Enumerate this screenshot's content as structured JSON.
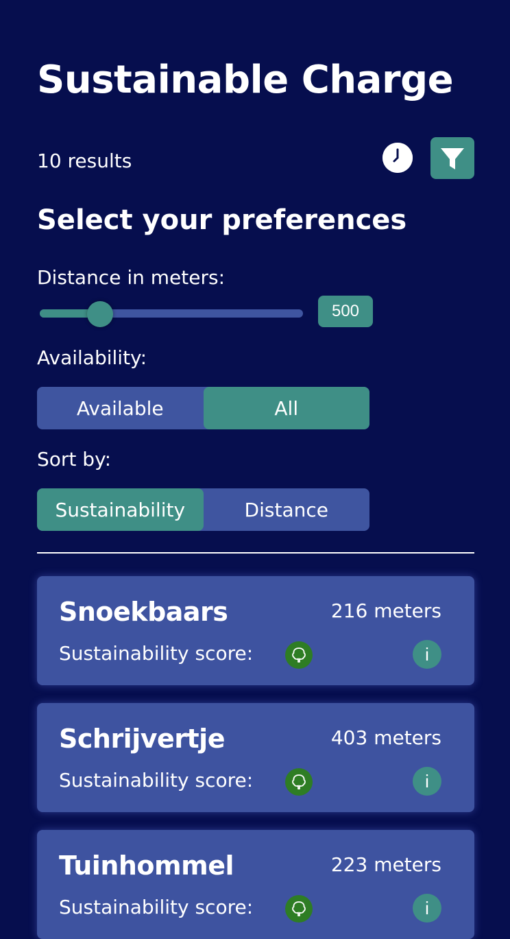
{
  "app": {
    "title": "Sustainable Charge"
  },
  "results": {
    "count_text": "10 results"
  },
  "preferences": {
    "heading": "Select your preferences",
    "distance": {
      "label": "Distance in meters:",
      "value": "500",
      "slider_fraction": 0.23
    },
    "availability": {
      "label": "Availability:",
      "options": [
        "Available",
        "All"
      ],
      "selected": "All"
    },
    "sort": {
      "label": "Sort by:",
      "options": [
        "Sustainability",
        "Distance"
      ],
      "selected": "Sustainability"
    }
  },
  "stations": [
    {
      "name": "Snoekbaars",
      "distance": "216 meters",
      "score_label": "Sustainability score:"
    },
    {
      "name": "Schrijvertje",
      "distance": "403 meters",
      "score_label": "Sustainability score:"
    },
    {
      "name": "Tuinhommel",
      "distance": "223 meters",
      "score_label": "Sustainability score:"
    }
  ],
  "icons": {
    "clock": "clock-icon",
    "filter": "filter-icon",
    "score": "tree-icon",
    "info": "info-icon",
    "info_glyph": "i"
  },
  "colors": {
    "background": "#060e4e",
    "accent": "#3f8f86",
    "panel": "#3f55a0",
    "score_green": "#2e7d24"
  }
}
